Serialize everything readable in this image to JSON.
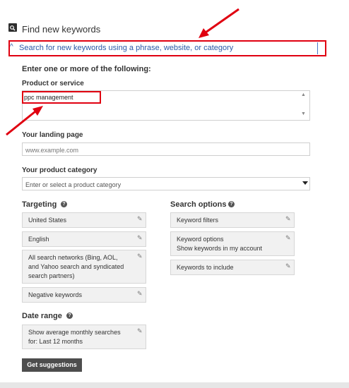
{
  "header": {
    "icon": "search-icon",
    "title": "Find new keywords"
  },
  "expander": {
    "icon": "chevron-up-icon",
    "label": "Search for new keywords using a phrase, website, or category"
  },
  "form": {
    "heading": "Enter one or more of the following:",
    "product": {
      "label": "Product or service",
      "value": "ppc management"
    },
    "landing": {
      "label": "Your landing page",
      "placeholder": "www.example.com"
    },
    "category": {
      "label": "Your product category",
      "placeholder": "Enter or select a product category"
    }
  },
  "targeting": {
    "heading": "Targeting",
    "help_icon": "?",
    "items": [
      {
        "line1": "United States"
      },
      {
        "line1": "English"
      },
      {
        "line1": "All search networks (Bing, AOL,",
        "line2": "and Yahoo search and syndicated",
        "line3": "search partners)"
      },
      {
        "line1": "Negative keywords"
      }
    ]
  },
  "search_options": {
    "heading": "Search options",
    "help_icon": "?",
    "items": [
      {
        "line1": "Keyword filters"
      },
      {
        "line1": "Keyword options",
        "line2": "Show keywords in my account"
      },
      {
        "line1": "Keywords to include"
      }
    ]
  },
  "date_range": {
    "heading": "Date range",
    "help_icon": "?",
    "line1": "Show average monthly searches",
    "line2": "for: Last 12 months"
  },
  "actions": {
    "get_suggestions": "Get suggestions"
  },
  "icons": {
    "pencil": "✎",
    "pencil_name": "pencil-icon"
  },
  "colors": {
    "annotation_red": "#e00010",
    "link_blue": "#2b5aa8",
    "button_dark": "#4d4d4d"
  }
}
